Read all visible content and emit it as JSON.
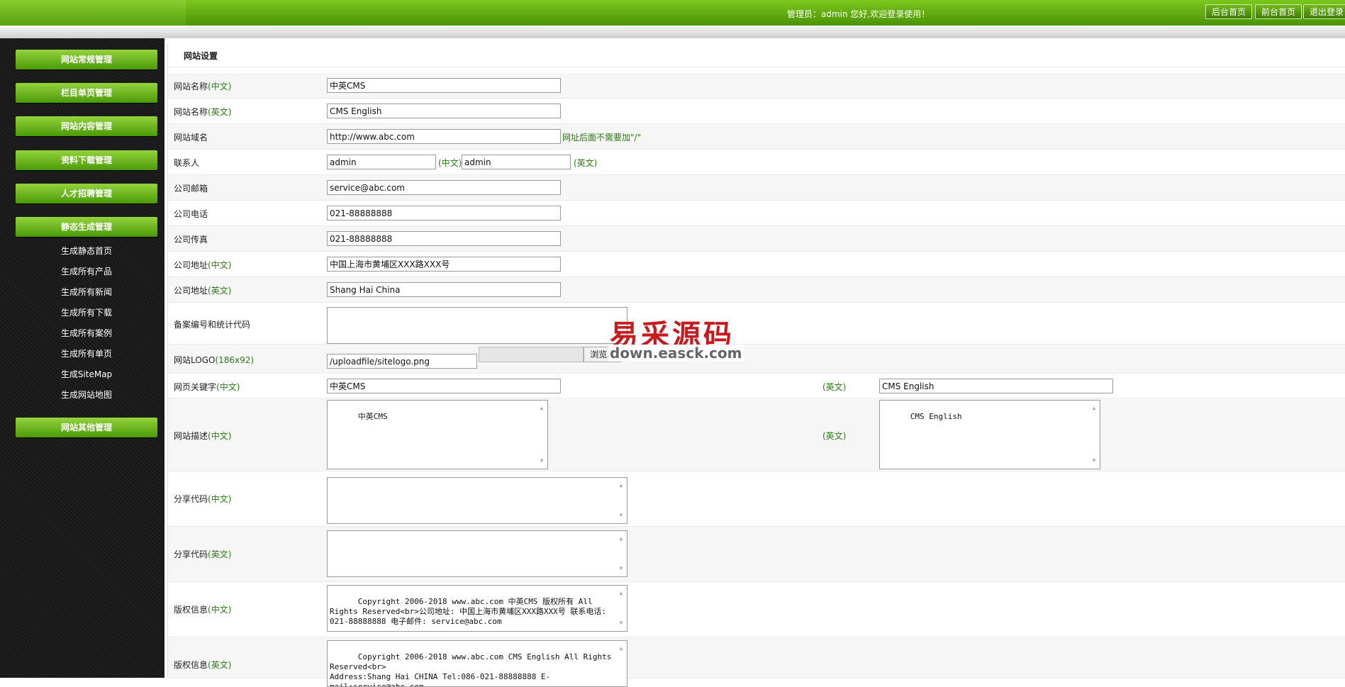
{
  "header": {
    "welcome": "管理员：admin 您好,欢迎登录使用！",
    "buttons": [
      "后台首页",
      "前台首页",
      "退出登录"
    ]
  },
  "sidebar": {
    "menus": [
      "网站常规管理",
      "栏目单页管理",
      "网站内容管理",
      "资料下载管理",
      "人才招聘管理",
      "静态生成管理",
      "网站其他管理"
    ],
    "sub_items": [
      "生成静态首页",
      "生成所有产品",
      "生成所有新闻",
      "生成所有下载",
      "生成所有案例",
      "生成所有单页",
      "生成SiteMap",
      "生成网站地图"
    ]
  },
  "panel": {
    "title": "网站设置",
    "site_name_cn": {
      "label": "网站名称",
      "tag": "(中文)",
      "value": "中英CMS"
    },
    "site_name_en": {
      "label": "网站名称",
      "tag": "(英文)",
      "value": "CMS English"
    },
    "domain": {
      "label": "网站域名",
      "value": "http://www.abc.com",
      "hint": "网址后面不需要加\"/\""
    },
    "contact": {
      "label": "联系人",
      "value_cn": "admin",
      "tag_cn": "(中文)",
      "value_en": "admin",
      "tag_en": "(英文)"
    },
    "email": {
      "label": "公司邮箱",
      "value": "service@abc.com"
    },
    "phone": {
      "label": "公司电话",
      "value": "021-88888888"
    },
    "fax": {
      "label": "公司传真",
      "value": "021-88888888"
    },
    "address_cn": {
      "label": "公司地址",
      "tag": "(中文)",
      "value": "中国上海市黄埔区XXX路XXX号"
    },
    "address_en": {
      "label": "公司地址",
      "tag": "(英文)",
      "value": "Shang Hai China"
    },
    "icp": {
      "label": "备案编号和统计代码",
      "value": ""
    },
    "logo": {
      "label": "网站LOGO",
      "tag": "(186x92)",
      "value": "/uploadfile/sitelogo.png",
      "browse": "浏览..."
    },
    "keywords": {
      "label": "网页关键字",
      "tag_cn": "(中文)",
      "value_cn": "中英CMS",
      "tag_en": "(英文)",
      "value_en": "CMS English"
    },
    "description": {
      "label": "网站描述",
      "tag_cn": "(中文)",
      "value_cn": "中英CMS",
      "tag_en": "(英文)",
      "value_en": "CMS English"
    },
    "share_cn": {
      "label": "分享代码",
      "tag": "(中文)",
      "value": ""
    },
    "share_en": {
      "label": "分享代码",
      "tag": "(英文)",
      "value": ""
    },
    "copyright_cn": {
      "label": "版权信息",
      "tag": "(中文)",
      "value": "Copyright 2006-2018 www.abc.com 中英CMS 版权所有 All Rights Reserved<br>公司地址: 中国上海市黄埔区XXX路XXX号 联系电话: 021-88888888 电子邮件: service@abc.com"
    },
    "copyright_en": {
      "label": "版权信息",
      "tag": "(英文)",
      "value": "Copyright 2006-2018 www.abc.com CMS English All Rights Reserved<br>\nAddress:Shang Hai CHINA Tel:086-021-88888888 E-mail:service@abc.com"
    }
  },
  "watermark": {
    "title": "易采源码",
    "url": "down.easck.com"
  }
}
